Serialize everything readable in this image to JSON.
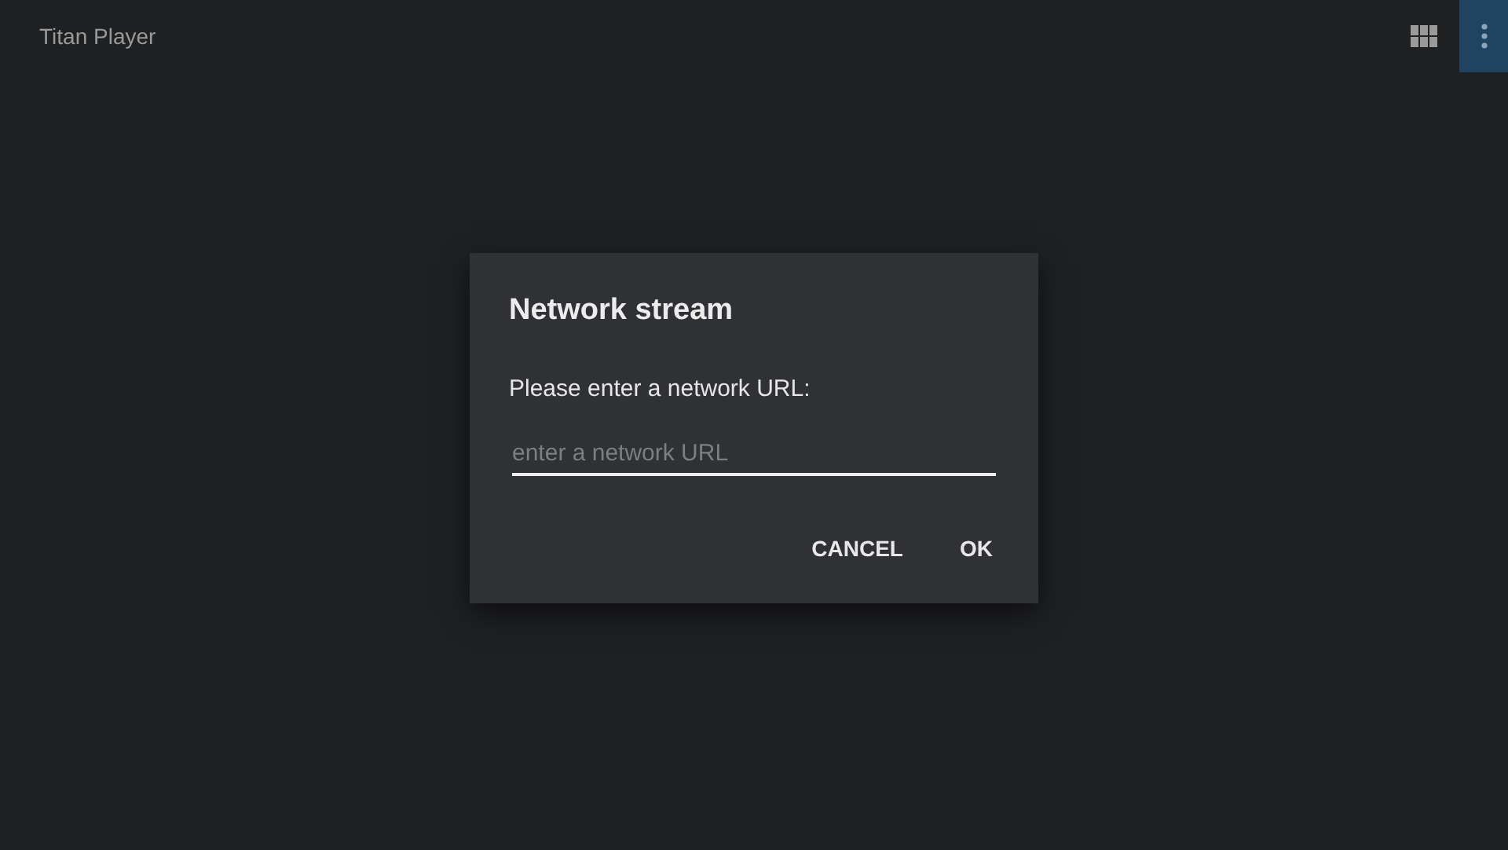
{
  "app_bar": {
    "title": "Titan Player",
    "menu_button": {
      "focused": true
    }
  },
  "dialog": {
    "title": "Network stream",
    "message": "Please enter a network URL:",
    "url_field": {
      "placeholder": "enter a network URL"
    },
    "buttons": [
      "CANCEL",
      "OK"
    ]
  }
}
